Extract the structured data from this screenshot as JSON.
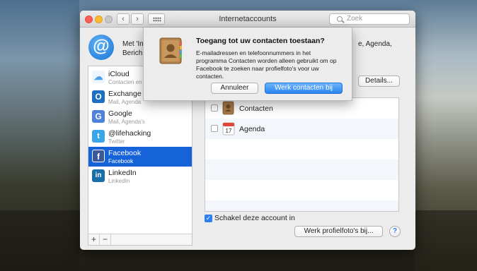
{
  "window": {
    "title": "Internetaccounts"
  },
  "toolbar": {
    "back": "‹",
    "forward": "›",
    "search_placeholder": "Zoek"
  },
  "header": {
    "line1_left": "Met 'In",
    "line1_right": "e, Agenda,",
    "line2": "Berich"
  },
  "sidebar": {
    "accounts": [
      {
        "name": "iCloud",
        "sub": "Contacten en",
        "icon": "icloud-icon",
        "color": "#f0f6fd"
      },
      {
        "name": "Exchange",
        "sub": "Mail, Agenda",
        "icon": "exchange-icon",
        "color": "#1d6fbf"
      },
      {
        "name": "Google",
        "sub": "Mail, Agenda's",
        "icon": "google-icon",
        "color": "#4f83d9"
      },
      {
        "name": "@lifehacking",
        "sub": "Twitter",
        "icon": "twitter-icon",
        "color": "#3aa6e8"
      },
      {
        "name": "Facebook",
        "sub": "Facebook",
        "icon": "facebook-icon",
        "color": "#3b5998"
      },
      {
        "name": "LinkedIn",
        "sub": "LinkedIn",
        "icon": "linkedin-icon",
        "color": "#1a6fa8"
      }
    ],
    "selected": "Facebook",
    "add": "+",
    "remove": "−"
  },
  "panel": {
    "details_label": "Details...",
    "services": [
      {
        "label": "Contacten",
        "icon": "contacts-icon",
        "checked": false
      },
      {
        "label": "Agenda",
        "icon": "calendar-icon",
        "checked": false
      }
    ],
    "calendar_day": "17",
    "enable_label": "Schakel deze account in",
    "enable_checked": true,
    "photos_button": "Werk profielfoto's bij...",
    "help": "?"
  },
  "dialog": {
    "title": "Toegang tot uw contacten toestaan?",
    "lines": [
      "E-mailadressen en telefoonnummers in het",
      "programma Contacten worden alleen gebruikt om op",
      "Facebook te zoeken naar profielfoto's voor uw",
      "contacten."
    ],
    "cancel": "Annuleer",
    "confirm": "Werk contacten bij"
  },
  "colors": {
    "selection": "#1663d9",
    "accent": "#2a86f2"
  }
}
